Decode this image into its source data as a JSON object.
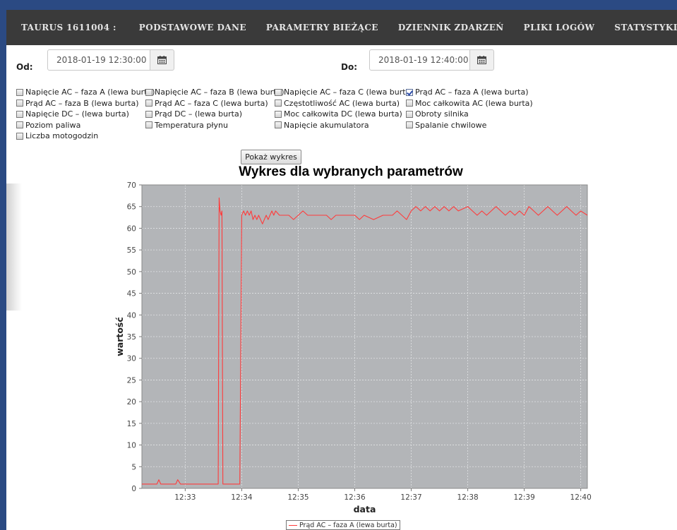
{
  "nav": {
    "items": [
      "TAURUS 1611004 :",
      "PODSTAWOWE DANE",
      "PARAMETRY BIEŻĄCE",
      "DZIENNIK ZDARZEŃ",
      "PLIKI LOGÓW",
      "STATYSTYKI"
    ]
  },
  "filters": {
    "from_label": "Od:",
    "from_value": "2018-01-19 12:30:00",
    "to_label": "Do:",
    "to_value": "2018-01-19 12:40:00",
    "calendar_icon": "calendar-icon"
  },
  "params": [
    {
      "label": "Napięcie AC – faza A (lewa burta)",
      "checked": false
    },
    {
      "label": "Napięcie AC – faza B (lewa burta)",
      "checked": false
    },
    {
      "label": "Napięcie AC – faza C (lewa burta)",
      "checked": false
    },
    {
      "label": "Prąd AC – faza A (lewa burta)",
      "checked": true
    },
    {
      "label": "Prąd AC – faza B (lewa burta)",
      "checked": false
    },
    {
      "label": "Prąd AC – faza C (lewa burta)",
      "checked": false
    },
    {
      "label": "Częstotliwość AC (lewa burta)",
      "checked": false
    },
    {
      "label": "Moc całkowita AC (lewa burta)",
      "checked": false
    },
    {
      "label": "Napięcie DC – (lewa burta)",
      "checked": false
    },
    {
      "label": "Prąd DC – (lewa burta)",
      "checked": false
    },
    {
      "label": "Moc całkowita DC (lewa burta)",
      "checked": false
    },
    {
      "label": "Obroty silnika",
      "checked": false
    },
    {
      "label": "Poziom paliwa",
      "checked": false
    },
    {
      "label": "Temperatura płynu",
      "checked": false
    },
    {
      "label": "Napięcie akumulatora",
      "checked": false
    },
    {
      "label": "Spalanie chwilowe",
      "checked": false
    },
    {
      "label": "Liczba motogodzin",
      "checked": false
    }
  ],
  "show_button": "Pokaż wykres",
  "chart_data": {
    "type": "line",
    "title": "Wykres dla wybranych parametrów",
    "xlabel": "data",
    "ylabel": "wartość",
    "ylim": [
      0,
      70
    ],
    "y_ticks": [
      0,
      5,
      10,
      15,
      20,
      25,
      30,
      35,
      40,
      45,
      50,
      55,
      60,
      65,
      70
    ],
    "x_range": [
      "12:32:14",
      "12:40:07"
    ],
    "x_ticks": [
      "12:33",
      "12:34",
      "12:35",
      "12:36",
      "12:37",
      "12:38",
      "12:39",
      "12:40"
    ],
    "grid": true,
    "legend_position": "bottom",
    "plot_background": "#b3b5b8",
    "series": [
      {
        "name": "Prąd AC – faza A (lewa burta)",
        "color": "#ff3b3b",
        "points": [
          [
            "12:32:14",
            1
          ],
          [
            "12:32:30",
            1
          ],
          [
            "12:32:32",
            2
          ],
          [
            "12:32:34",
            1
          ],
          [
            "12:32:50",
            1
          ],
          [
            "12:32:52",
            2
          ],
          [
            "12:32:55",
            1
          ],
          [
            "12:33:35",
            1
          ],
          [
            "12:33:36",
            67
          ],
          [
            "12:33:37",
            64
          ],
          [
            "12:33:38",
            63
          ],
          [
            "12:33:39",
            64
          ],
          [
            "12:33:40",
            1
          ],
          [
            "12:33:58",
            1
          ],
          [
            "12:34:00",
            63
          ],
          [
            "12:34:02",
            64
          ],
          [
            "12:34:04",
            63
          ],
          [
            "12:34:06",
            64
          ],
          [
            "12:34:08",
            63
          ],
          [
            "12:34:10",
            64
          ],
          [
            "12:34:12",
            62
          ],
          [
            "12:34:14",
            63
          ],
          [
            "12:34:16",
            62
          ],
          [
            "12:34:18",
            63
          ],
          [
            "12:34:20",
            62
          ],
          [
            "12:34:22",
            61
          ],
          [
            "12:34:24",
            62
          ],
          [
            "12:34:26",
            63
          ],
          [
            "12:34:28",
            62
          ],
          [
            "12:34:30",
            63
          ],
          [
            "12:34:32",
            64
          ],
          [
            "12:34:34",
            63
          ],
          [
            "12:34:36",
            64
          ],
          [
            "12:34:40",
            63
          ],
          [
            "12:34:50",
            63
          ],
          [
            "12:34:55",
            62
          ],
          [
            "12:35:00",
            63
          ],
          [
            "12:35:05",
            64
          ],
          [
            "12:35:10",
            63
          ],
          [
            "12:35:30",
            63
          ],
          [
            "12:35:35",
            62
          ],
          [
            "12:35:40",
            63
          ],
          [
            "12:36:00",
            63
          ],
          [
            "12:36:05",
            62
          ],
          [
            "12:36:10",
            63
          ],
          [
            "12:36:20",
            62
          ],
          [
            "12:36:30",
            63
          ],
          [
            "12:36:40",
            63
          ],
          [
            "12:36:45",
            64
          ],
          [
            "12:36:50",
            63
          ],
          [
            "12:36:55",
            62
          ],
          [
            "12:37:00",
            64
          ],
          [
            "12:37:05",
            65
          ],
          [
            "12:37:10",
            64
          ],
          [
            "12:37:15",
            65
          ],
          [
            "12:37:20",
            64
          ],
          [
            "12:37:25",
            65
          ],
          [
            "12:37:30",
            64
          ],
          [
            "12:37:35",
            65
          ],
          [
            "12:37:40",
            64
          ],
          [
            "12:37:45",
            65
          ],
          [
            "12:37:50",
            64
          ],
          [
            "12:38:00",
            65
          ],
          [
            "12:38:05",
            64
          ],
          [
            "12:38:10",
            63
          ],
          [
            "12:38:15",
            64
          ],
          [
            "12:38:20",
            63
          ],
          [
            "12:38:25",
            64
          ],
          [
            "12:38:30",
            65
          ],
          [
            "12:38:35",
            64
          ],
          [
            "12:38:40",
            63
          ],
          [
            "12:38:45",
            64
          ],
          [
            "12:38:50",
            63
          ],
          [
            "12:38:55",
            64
          ],
          [
            "12:39:00",
            63
          ],
          [
            "12:39:05",
            65
          ],
          [
            "12:39:10",
            64
          ],
          [
            "12:39:15",
            63
          ],
          [
            "12:39:20",
            64
          ],
          [
            "12:39:25",
            65
          ],
          [
            "12:39:30",
            64
          ],
          [
            "12:39:35",
            63
          ],
          [
            "12:39:40",
            64
          ],
          [
            "12:39:45",
            65
          ],
          [
            "12:39:50",
            64
          ],
          [
            "12:39:55",
            63
          ],
          [
            "12:40:00",
            64
          ],
          [
            "12:40:07",
            63
          ]
        ]
      }
    ]
  }
}
